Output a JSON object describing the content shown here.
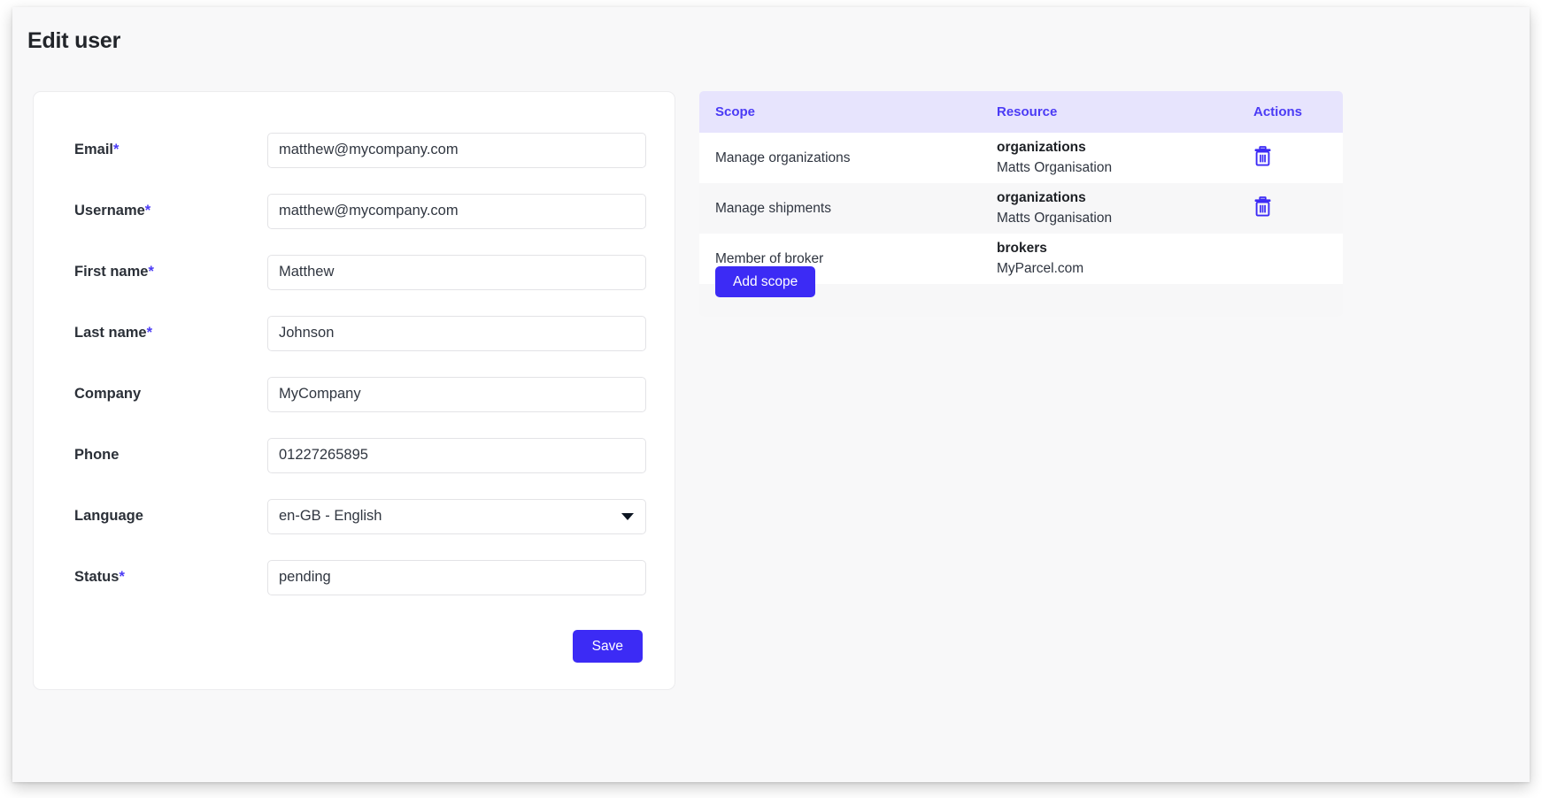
{
  "page": {
    "title": "Edit user"
  },
  "form": {
    "fields": [
      {
        "label": "Email",
        "required": true,
        "value": "matthew@mycompany.com",
        "placeholder": "",
        "type": "text"
      },
      {
        "label": "Username",
        "required": true,
        "value": "matthew@mycompany.com",
        "placeholder": "",
        "type": "text"
      },
      {
        "label": "First name",
        "required": true,
        "value": "Matthew",
        "placeholder": "",
        "type": "text"
      },
      {
        "label": "Last name",
        "required": true,
        "value": "Johnson",
        "placeholder": "",
        "type": "text"
      },
      {
        "label": "Company",
        "required": false,
        "value": "MyCompany",
        "placeholder": "",
        "type": "text"
      },
      {
        "label": "Phone",
        "required": false,
        "value": "01227265895",
        "placeholder": "",
        "type": "text"
      },
      {
        "label": "Language",
        "required": false,
        "value": "en-GB - English",
        "placeholder": "",
        "type": "select"
      },
      {
        "label": "Status",
        "required": true,
        "value": "pending",
        "placeholder": "",
        "type": "text"
      }
    ],
    "save_label": "Save"
  },
  "scopes": {
    "columns": {
      "scope": "Scope",
      "resource": "Resource",
      "actions": "Actions"
    },
    "rows": [
      {
        "scope": "Manage organizations",
        "resource_type": "organizations",
        "resource_name": "Matts Organisation",
        "has_delete": true,
        "delete_icon": "trash-icon"
      },
      {
        "scope": "Manage shipments",
        "resource_type": "organizations",
        "resource_name": "Matts Organisation",
        "has_delete": true,
        "delete_icon": "trash-icon"
      },
      {
        "scope": "Member of broker",
        "resource_type": "brokers",
        "resource_name": "MyParcel.com",
        "has_delete": false,
        "delete_icon": ""
      }
    ],
    "add_label": "Add scope"
  },
  "colors": {
    "accent": "#3c2bf5",
    "accent_text": "#4b3bf5",
    "table_header_bg": "#e7e4fd",
    "row_alt_bg": "#f7f7f8",
    "page_bg": "#f8f8f9",
    "label_text": "#2b3038"
  }
}
